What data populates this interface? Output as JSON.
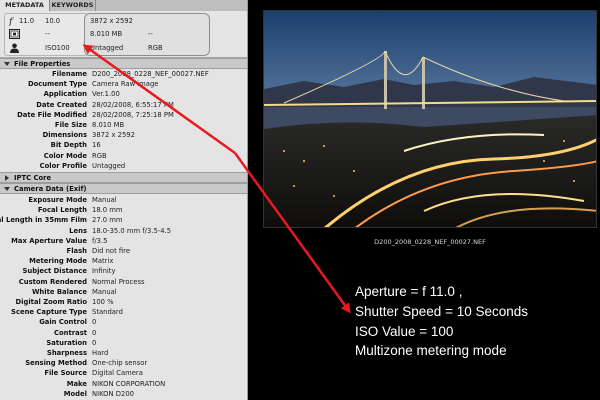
{
  "tabs": {
    "metadata": "METADATA",
    "keywords": "KEYWORDS"
  },
  "summary": {
    "aperture": "11.0",
    "shutter": "10.0",
    "metering": "--",
    "iso": "ISO100",
    "dimensions": "3872 x 2592",
    "file_size": "8.010 MB",
    "blank": "--",
    "label": "Untagged",
    "color_mode": "RGB"
  },
  "sections": {
    "file_properties": "File Properties",
    "iptc_core": "IPTC Core",
    "camera_data": "Camera Data (Exif)"
  },
  "file_properties": [
    {
      "key": "Filename",
      "value": "D200_2008_0228_NEF_00027.NEF"
    },
    {
      "key": "Document Type",
      "value": "Camera Raw image"
    },
    {
      "key": "Application",
      "value": "Ver.1.00"
    },
    {
      "key": "Date Created",
      "value": "28/02/2008, 6:55:17 PM"
    },
    {
      "key": "Date File Modified",
      "value": "28/02/2008, 7:25:18 PM"
    },
    {
      "key": "File Size",
      "value": "8.010 MB"
    },
    {
      "key": "Dimensions",
      "value": "3872 x 2592"
    },
    {
      "key": "Bit Depth",
      "value": "16"
    },
    {
      "key": "Color Mode",
      "value": "RGB"
    },
    {
      "key": "Color Profile",
      "value": "Untagged"
    }
  ],
  "camera_data": [
    {
      "key": "Exposure Mode",
      "value": "Manual"
    },
    {
      "key": "Focal Length",
      "value": "18.0 mm"
    },
    {
      "key": "Focal Length in 35mm Film",
      "value": "27.0 mm"
    },
    {
      "key": "Lens",
      "value": "18.0-35.0 mm f/3.5-4.5"
    },
    {
      "key": "Max Aperture Value",
      "value": "f/3.5"
    },
    {
      "key": "Flash",
      "value": "Did not fire"
    },
    {
      "key": "Metering Mode",
      "value": "Matrix"
    },
    {
      "key": "Subject Distance",
      "value": "Infinity"
    },
    {
      "key": "Custom Rendered",
      "value": "Normal Process"
    },
    {
      "key": "White Balance",
      "value": "Manual"
    },
    {
      "key": "Digital Zoom Ratio",
      "value": "100 %"
    },
    {
      "key": "Scene Capture Type",
      "value": "Standard"
    },
    {
      "key": "Gain Control",
      "value": "0"
    },
    {
      "key": "Contrast",
      "value": "0"
    },
    {
      "key": "Saturation",
      "value": "0"
    },
    {
      "key": "Sharpness",
      "value": "Hard"
    },
    {
      "key": "Sensing Method",
      "value": "One-chip sensor"
    },
    {
      "key": "File Source",
      "value": "Digital Camera"
    },
    {
      "key": "Make",
      "value": "NIKON CORPORATION"
    },
    {
      "key": "Model",
      "value": "NIKON D200"
    }
  ],
  "photo": {
    "caption": "D200_2008_0228_NEF_00027.NEF"
  },
  "annotations": [
    "Aperture = f 11.0 ,",
    "Shutter Speed = 10 Seconds",
    "ISO  Value = 100",
    "Multizone metering mode"
  ],
  "colors": {
    "arrow": "#e8191f",
    "panel_bg": "#e4e4e4",
    "section_bg": "#c9c9c9"
  },
  "icons": [
    "aperture-icon",
    "metering-icon",
    "person-icon"
  ]
}
